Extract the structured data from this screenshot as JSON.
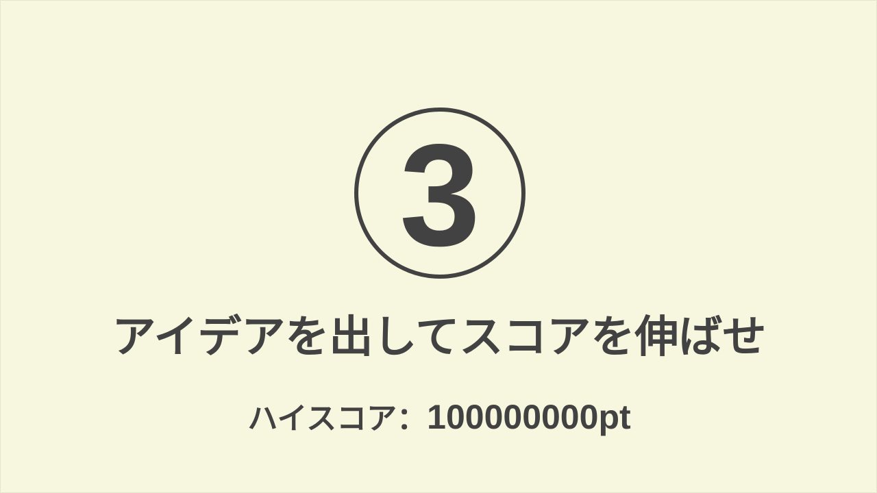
{
  "countdown": {
    "value": "3"
  },
  "title": "アイデアを出してスコアを伸ばせ",
  "high_score": {
    "label": "ハイスコア：",
    "value": "100000000",
    "unit": "pt"
  }
}
